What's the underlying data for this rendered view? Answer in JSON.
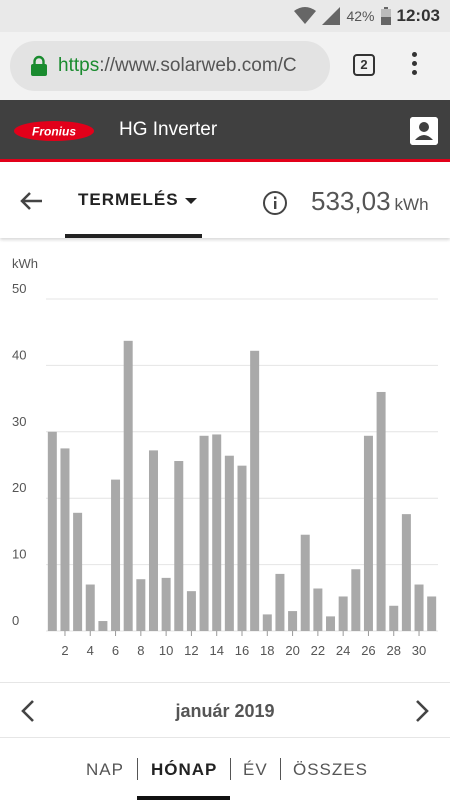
{
  "status_bar": {
    "battery": "42%",
    "time": "12:03",
    "icons": [
      "wifi-icon",
      "signal-icon",
      "battery-icon"
    ]
  },
  "browser": {
    "url_scheme": "https",
    "url_rest": "://www.solarweb.com/C",
    "tab_count": "2",
    "lock_color": "#1a8b2f"
  },
  "app_bar": {
    "brand": "Fronius",
    "title": "HG Inverter",
    "brand_color": "#e2001a"
  },
  "header": {
    "selector_label": "TERMELÉS",
    "total_value": "533,03",
    "total_unit": "kWh"
  },
  "chart_data": {
    "type": "bar",
    "ylabel": "kWh",
    "ylim": [
      0,
      50
    ],
    "yticks": [
      0,
      10,
      20,
      30,
      40,
      50
    ],
    "grid": true,
    "x": [
      1,
      2,
      3,
      4,
      5,
      6,
      7,
      8,
      9,
      10,
      11,
      12,
      13,
      14,
      15,
      16,
      17,
      18,
      19,
      20,
      21,
      22,
      23,
      24,
      25,
      26,
      27,
      28,
      29,
      30,
      31
    ],
    "xtick_labels": [
      "2",
      "4",
      "6",
      "8",
      "10",
      "12",
      "14",
      "16",
      "18",
      "20",
      "22",
      "24",
      "26",
      "28",
      "30"
    ],
    "values": [
      30.0,
      27.5,
      17.8,
      7.0,
      1.5,
      22.8,
      43.7,
      7.8,
      27.2,
      8.0,
      25.6,
      6.0,
      29.4,
      29.6,
      26.4,
      24.9,
      42.2,
      2.5,
      8.6,
      3.0,
      14.5,
      6.4,
      2.2,
      5.2,
      9.3,
      29.4,
      36.0,
      3.8,
      17.6,
      7.0,
      5.2
    ],
    "bar_color": "#a9a9a9"
  },
  "date_nav": {
    "label": "január 2019"
  },
  "bottom_nav": {
    "tabs": [
      "NAP",
      "HÓNAP",
      "ÉV",
      "ÖSSZES"
    ],
    "active_index": 1
  }
}
